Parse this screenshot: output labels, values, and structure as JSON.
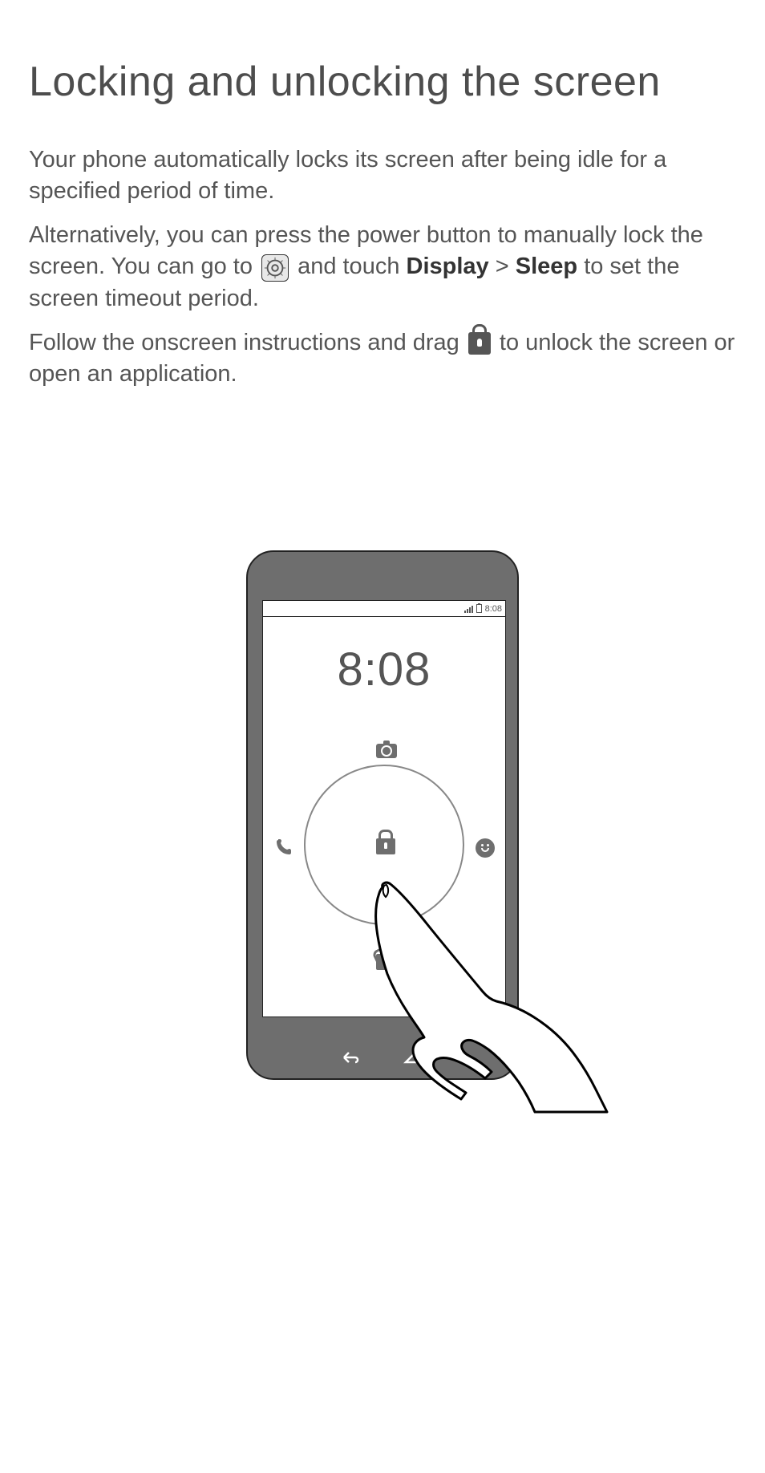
{
  "title": "Locking and unlocking the screen",
  "para1": "Your phone automatically locks its screen after being idle for a specified period of time.",
  "para2a": "Alternatively, you can press the power button to manually lock the screen. You can go to ",
  "para2b": " and touch ",
  "para2_display": "Display",
  "para2c": " > ",
  "para2_sleep": "Sleep",
  "para2d": " to set the screen timeout period.",
  "para3a": "Follow the onscreen instructions and drag ",
  "para3b": " to unlock the screen or open an application.",
  "phone": {
    "status_time": "8:08",
    "clock": "8:08"
  }
}
